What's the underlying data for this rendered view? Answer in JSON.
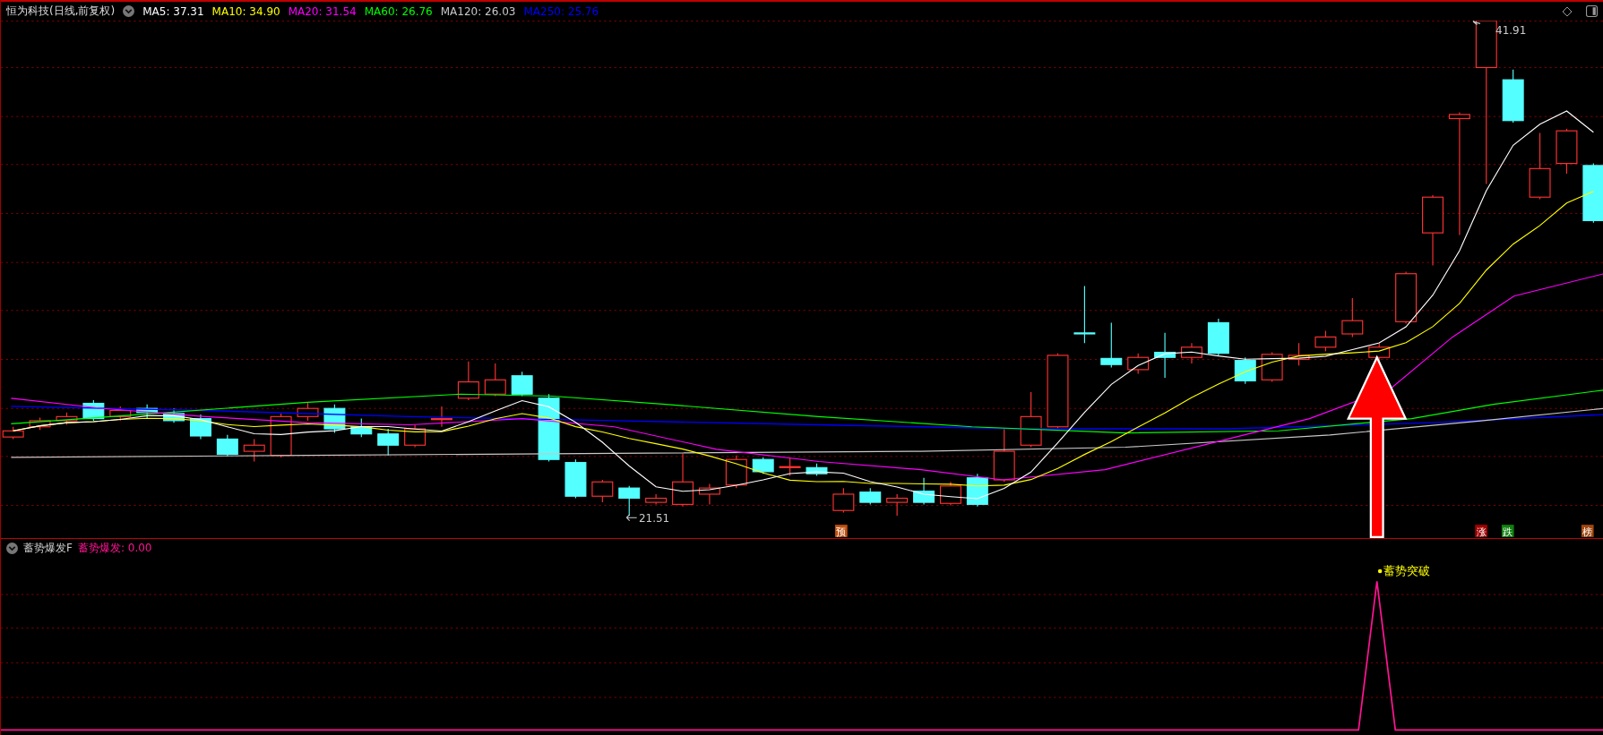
{
  "header": {
    "title": "恒为科技(日线,前复权)",
    "indicators": [
      {
        "label": "MA5: 37.31",
        "color": "#ffffff"
      },
      {
        "label": "MA10: 34.90",
        "color": "#ffff00"
      },
      {
        "label": "MA20: 31.54",
        "color": "#ff00ff"
      },
      {
        "label": "MA60: 26.76",
        "color": "#00ff00"
      },
      {
        "label": "MA120: 26.03",
        "color": "#c8c8c8"
      },
      {
        "label": "MA250: 25.76",
        "color": "#0000ff"
      }
    ]
  },
  "price_chart": {
    "high_label": "41.91",
    "low_label": "21.51",
    "markers": [
      {
        "text": "预",
        "color": "#c05010"
      },
      {
        "text": "涨",
        "color": "#a00000"
      },
      {
        "text": "跌",
        "color": "#108010"
      },
      {
        "text": "榜",
        "color": "#a04810"
      }
    ]
  },
  "indicator_panel": {
    "title": "蓄势爆发F",
    "reading": "蓄势爆发: 0.00",
    "signal_label": "蓄势突破"
  }
}
